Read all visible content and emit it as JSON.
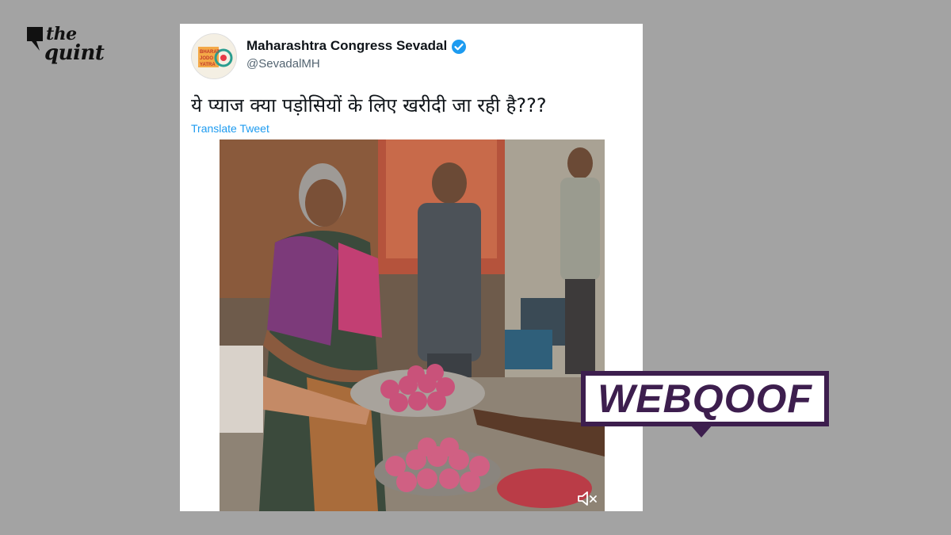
{
  "logo": {
    "the": "the",
    "name": "quint"
  },
  "tweet": {
    "display_name": "Maharashtra Congress Sevadal",
    "handle": "@SevadalMH",
    "avatar_text": [
      "BHARAT",
      "JODO",
      "YATRA"
    ],
    "text": "ये प्याज क्या पड़ोसियों के लिए खरीदी जा रही है???",
    "translate_label": "Translate Tweet"
  },
  "media": {
    "icons": [
      "mute-icon"
    ]
  },
  "badge": {
    "label": "WEBQOOF"
  },
  "colors": {
    "background": "#a3a3a3",
    "badge": "#3d1e4e",
    "link": "#1d9bf0",
    "verified": "#1d9bf0"
  }
}
